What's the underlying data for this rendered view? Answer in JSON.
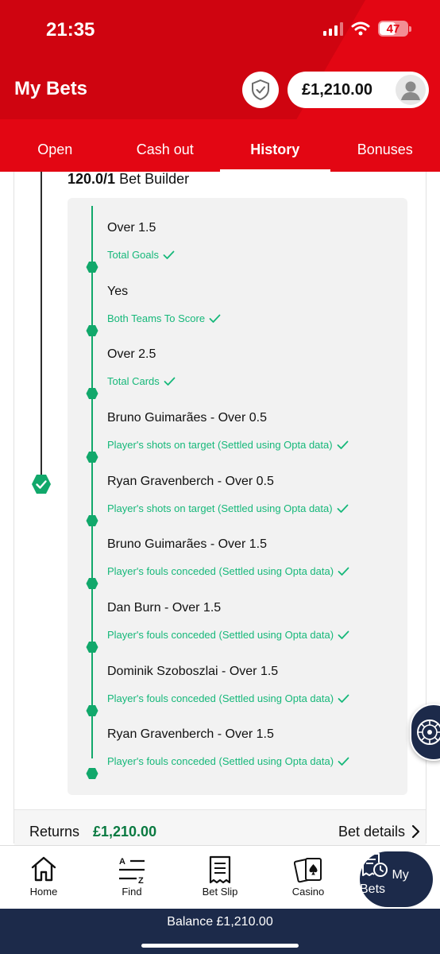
{
  "status_bar": {
    "time": "21:35",
    "battery": "47"
  },
  "header": {
    "title": "My Bets",
    "balance": "£1,210.00"
  },
  "tabs": [
    {
      "label": "Open",
      "active": false
    },
    {
      "label": "Cash out",
      "active": false
    },
    {
      "label": "History",
      "active": true
    },
    {
      "label": "Bonuses",
      "active": false
    }
  ],
  "bet": {
    "odds": "120.0/1",
    "type": "Bet Builder",
    "status": "won",
    "legs": [
      {
        "selection": "Over 1.5",
        "market": "Total Goals"
      },
      {
        "selection": "Yes",
        "market": "Both Teams To Score"
      },
      {
        "selection": "Over 2.5",
        "market": "Total Cards"
      },
      {
        "selection": "Bruno Guimarães - Over 0.5",
        "market": "Player's shots on target (Settled using Opta data)"
      },
      {
        "selection": "Ryan Gravenberch - Over 0.5",
        "market": "Player's shots on target (Settled using Opta data)"
      },
      {
        "selection": "Bruno Guimarães - Over 1.5",
        "market": "Player's fouls conceded (Settled using Opta data)"
      },
      {
        "selection": "Dan Burn - Over 1.5",
        "market": "Player's fouls conceded (Settled using Opta data)"
      },
      {
        "selection": "Dominik Szoboszlai - Over 1.5",
        "market": "Player's fouls conceded (Settled using Opta data)"
      },
      {
        "selection": "Ryan Gravenberch - Over 1.5",
        "market": "Player's fouls conceded (Settled using Opta data)"
      }
    ],
    "returns_label": "Returns",
    "returns_value": "£1,210.00",
    "details_label": "Bet details"
  },
  "bottom_nav": {
    "items": [
      {
        "label": "Home",
        "icon": "home-icon"
      },
      {
        "label": "Find",
        "icon": "find-icon"
      },
      {
        "label": "Bet Slip",
        "icon": "bet-slip-icon"
      },
      {
        "label": "Casino",
        "icon": "casino-icon"
      },
      {
        "label": "My Bets",
        "icon": "my-bets-icon",
        "active": true
      }
    ]
  },
  "balance_bar": {
    "text": "Balance £1,210.00"
  },
  "colors": {
    "brand_red": "#e30613",
    "navy": "#1c2a4a",
    "success_green": "#16b87a",
    "returns_green": "#0a7a41"
  }
}
